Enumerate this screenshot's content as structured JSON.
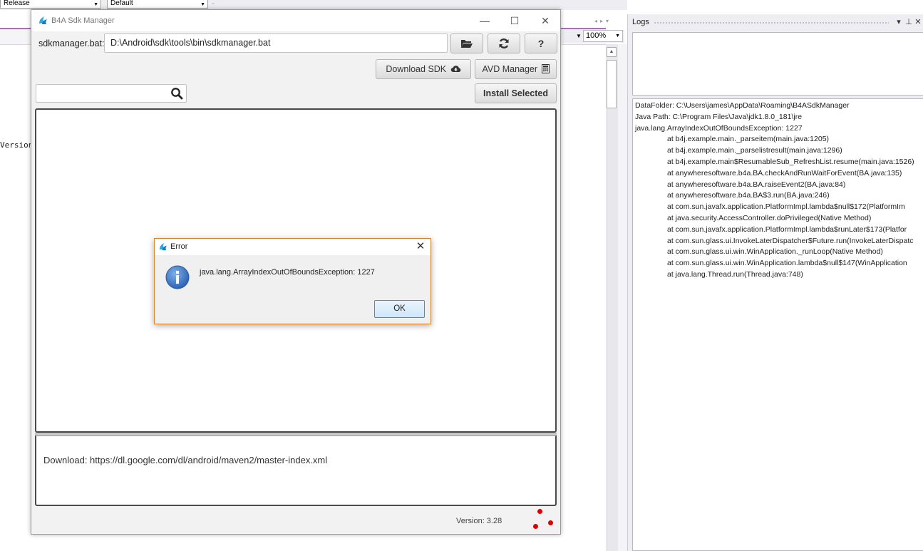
{
  "ide": {
    "config_combo": "Release",
    "theme_combo": "Default",
    "editor_fragment": "Version",
    "zoom": "100%"
  },
  "logs": {
    "title": "Logs",
    "lines": [
      "DataFolder: C:\\Users\\james\\AppData\\Roaming\\B4ASdkManager",
      "Java Path: C:\\Program Files\\Java\\jdk1.8.0_181\\jre",
      "java.lang.ArrayIndexOutOfBoundsException: 1227"
    ],
    "stack": [
      "at b4j.example.main._parseitem(main.java:1205)",
      "at b4j.example.main._parselistresult(main.java:1296)",
      "at b4j.example.main$ResumableSub_RefreshList.resume(main.java:1526)",
      "at anywheresoftware.b4a.BA.checkAndRunWaitForEvent(BA.java:135)",
      "at anywheresoftware.b4a.BA.raiseEvent2(BA.java:84)",
      "at anywheresoftware.b4a.BA$3.run(BA.java:246)",
      "at com.sun.javafx.application.PlatformImpl.lambda$null$172(PlatformIm",
      "at java.security.AccessController.doPrivileged(Native Method)",
      "at com.sun.javafx.application.PlatformImpl.lambda$runLater$173(Platfor",
      "at com.sun.glass.ui.InvokeLaterDispatcher$Future.run(InvokeLaterDispatc",
      "at com.sun.glass.ui.win.WinApplication._runLoop(Native Method)",
      "at com.sun.glass.ui.win.WinApplication.lambda$null$147(WinApplication",
      "at java.lang.Thread.run(Thread.java:748)"
    ]
  },
  "sdk": {
    "title": "B4A Sdk Manager",
    "path_label": "sdkmanager.bat:",
    "path_value": "D:\\Android\\sdk\\tools\\bin\\sdkmanager.bat",
    "help_label": "?",
    "download_sdk_label": "Download SDK",
    "avd_manager_label": "AVD Manager",
    "install_selected_label": "Install Selected",
    "search_value": "",
    "log_text": "Download: https://dl.google.com/dl/android/maven2/master-index.xml",
    "version": "Version: 3.28"
  },
  "error_dialog": {
    "title": "Error",
    "message": "java.lang.ArrayIndexOutOfBoundsException: 1227",
    "ok_label": "OK"
  },
  "colors": {
    "accent_blue": "#3d8ee0",
    "info_icon": "#3a75c4",
    "dialog_border": "#d6862e",
    "ide_purple": "#b06cc0",
    "red_dots": "#e10000"
  }
}
